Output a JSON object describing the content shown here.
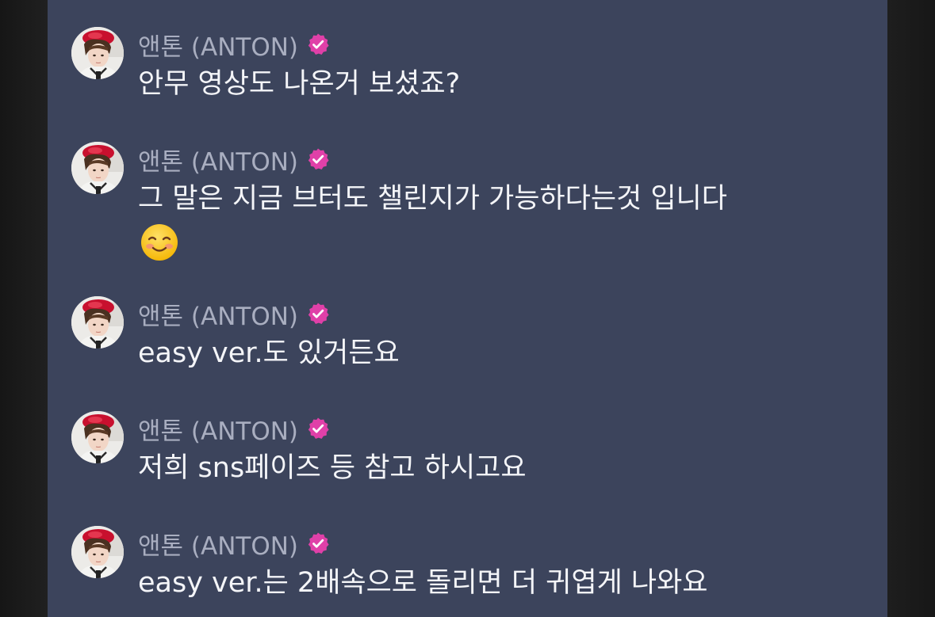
{
  "chat": {
    "messages": [
      {
        "sender": "앤톤 (ANTON)",
        "text": "안무 영상도 나온거 보셨죠?"
      },
      {
        "sender": "앤톤 (ANTON)",
        "text": "그 말은 지금 브터도 챌린지가 가능하다는것 입니다",
        "emoji": "smiling-face-emoji"
      },
      {
        "sender": "앤톤 (ANTON)",
        "text": "easy ver.도 있거든요"
      },
      {
        "sender": "앤톤 (ANTON)",
        "text": "저희 sns페이즈 등 참고 하시고요"
      },
      {
        "sender": "앤톤 (ANTON)",
        "text": "easy ver.는 2배속으로 돌리면 더 귀엽게 나와요"
      }
    ]
  },
  "colors": {
    "panel_bg": "#3c445c",
    "side_bg": "#141414",
    "name_text": "#a9aec0",
    "message_text": "#f4f5f8",
    "verified_badge": "#e040a8"
  },
  "icons": {
    "verified": "verified-badge-icon",
    "avatar": "avatar",
    "emoji": "smiling-face-emoji"
  }
}
